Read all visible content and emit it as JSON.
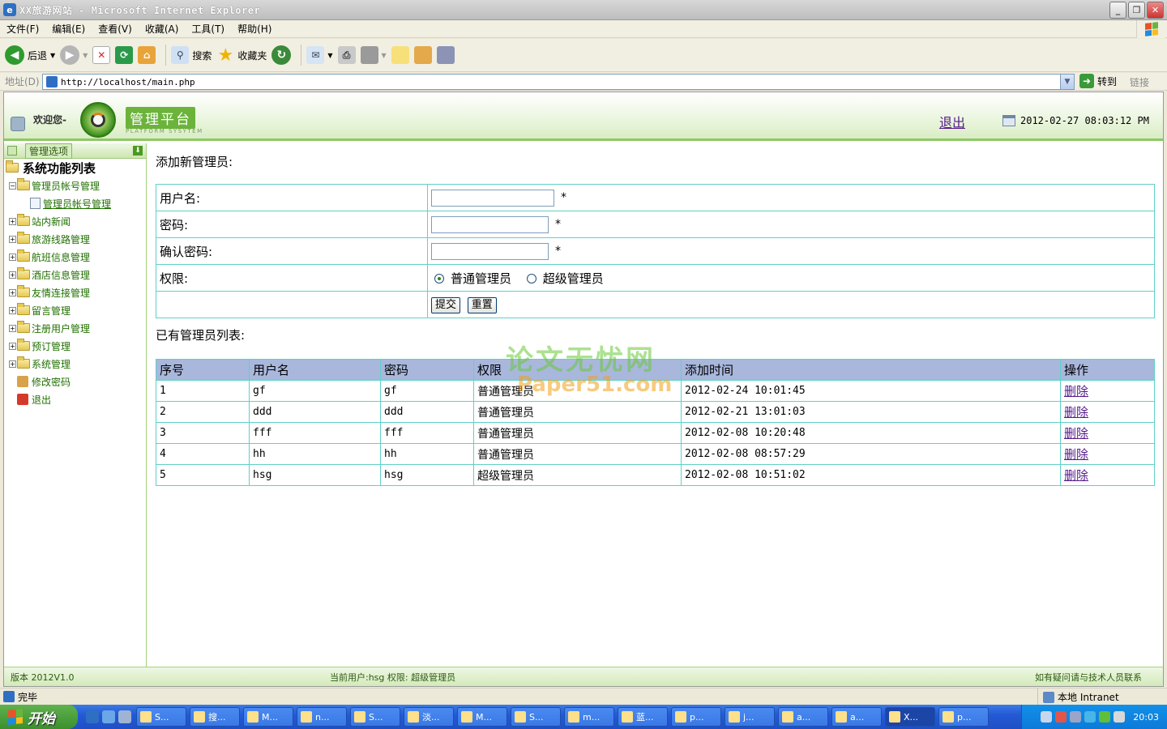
{
  "window": {
    "title": "XX旅游网站 - Microsoft Internet Explorer"
  },
  "menu": [
    "文件(F)",
    "编辑(E)",
    "查看(V)",
    "收藏(A)",
    "工具(T)",
    "帮助(H)"
  ],
  "toolbar": {
    "back": "后退",
    "search": "搜索",
    "favorites": "收藏夹"
  },
  "address": {
    "label": "地址(D)",
    "url": "http://localhost/main.php",
    "go": "转到",
    "links": "链接"
  },
  "header": {
    "welcome": "欢迎您-",
    "brand": "管理平台",
    "brand_sub": "PLATFORM SYSYTEM",
    "logout": "退出",
    "datetime": "2012-02-27 08:03:12 PM"
  },
  "sidebar": {
    "tab": "管理选项",
    "root": "系统功能列表",
    "items": [
      {
        "label": "管理员帐号管理",
        "expanded": true
      },
      {
        "label": "管理员帐号管理",
        "child": true
      },
      {
        "label": "站内新闻"
      },
      {
        "label": "旅游线路管理"
      },
      {
        "label": "航班信息管理"
      },
      {
        "label": "酒店信息管理"
      },
      {
        "label": "友情连接管理"
      },
      {
        "label": "留言管理"
      },
      {
        "label": "注册用户管理"
      },
      {
        "label": "预订管理"
      },
      {
        "label": "系统管理"
      },
      {
        "label": "修改密码"
      },
      {
        "label": "退出"
      }
    ]
  },
  "form": {
    "title": "添加新管理员:",
    "username_label": "用户名:",
    "password_label": "密码:",
    "confirm_label": "确认密码:",
    "role_label": "权限:",
    "required_mark": "*",
    "role_options": [
      "普通管理员",
      "超级管理员"
    ],
    "role_selected": "普通管理员",
    "submit": "提交",
    "reset": "重置"
  },
  "admin_list": {
    "title": "已有管理员列表:",
    "columns": [
      "序号",
      "用户名",
      "密码",
      "权限",
      "添加时间",
      "操作"
    ],
    "rows": [
      [
        "1",
        "gf",
        "gf",
        "普通管理员",
        "2012-02-24 10:01:45",
        "删除"
      ],
      [
        "2",
        "ddd",
        "ddd",
        "普通管理员",
        "2012-02-21 13:01:03",
        "删除"
      ],
      [
        "3",
        "fff",
        "fff",
        "普通管理员",
        "2012-02-08 10:20:48",
        "删除"
      ],
      [
        "4",
        "hh",
        "hh",
        "普通管理员",
        "2012-02-08 08:57:29",
        "删除"
      ],
      [
        "5",
        "hsg",
        "hsg",
        "超级管理员",
        "2012-02-08 10:51:02",
        "删除"
      ]
    ]
  },
  "watermark": {
    "line1": "论文无忧网",
    "line2": "Paper51.com"
  },
  "footer": {
    "version": "版本 2012V1.0",
    "current_user": "当前用户:hsg 权限: 超级管理员",
    "help": "如有疑问请与技术人员联系"
  },
  "status": {
    "text": "完毕",
    "zone": "本地 Intranet"
  },
  "taskbar": {
    "start": "开始",
    "tasks": [
      "S...",
      "搜...",
      "M...",
      "n...",
      "S...",
      "淡...",
      "M...",
      "S...",
      "m...",
      "蓝...",
      "p...",
      "j...",
      "a...",
      "a...",
      "X...",
      "p..."
    ],
    "clock": "20:03"
  }
}
